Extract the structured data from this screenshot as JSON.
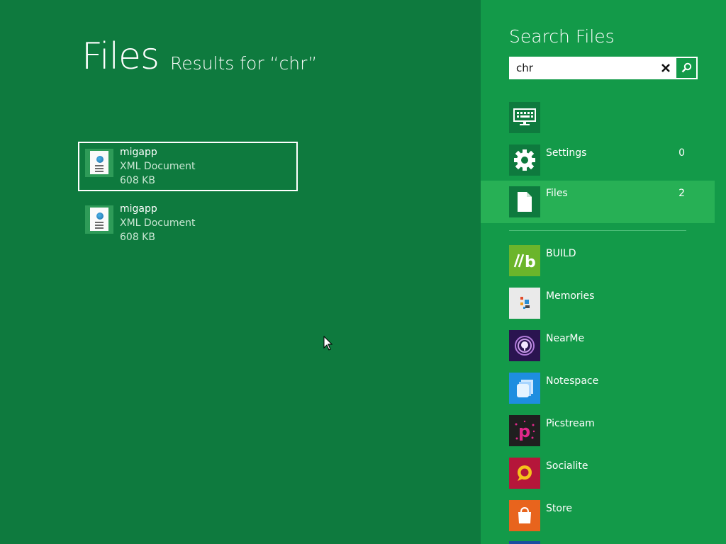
{
  "page": {
    "title": "Files",
    "subtitle": "Results for “chr”"
  },
  "results": [
    {
      "name": "migapp",
      "type": "XML Document",
      "size": "608 KB"
    },
    {
      "name": "migapp",
      "type": "XML Document",
      "size": "608 KB"
    }
  ],
  "search": {
    "title": "Search Files",
    "query": "chr"
  },
  "scopes": [
    {
      "label": "",
      "count": "",
      "icon": "keyboard-icon"
    },
    {
      "label": "Settings",
      "count": "0",
      "icon": "gear-icon"
    },
    {
      "label": "Files",
      "count": "2",
      "icon": "file-icon"
    }
  ],
  "apps": [
    {
      "label": "BUILD",
      "icon": "build-app-icon",
      "color": "#6bb52b"
    },
    {
      "label": "Memories",
      "icon": "memories-app-icon",
      "color": "#eaeaea"
    },
    {
      "label": "NearMe",
      "icon": "nearme-app-icon",
      "color": "#2a1450"
    },
    {
      "label": "Notespace",
      "icon": "notespace-app-icon",
      "color": "#1e8ee0"
    },
    {
      "label": "Picstream",
      "icon": "picstream-app-icon",
      "color": "#1f1f1f"
    },
    {
      "label": "Socialite",
      "icon": "socialite-app-icon",
      "color": "#b5163a"
    },
    {
      "label": "Store",
      "icon": "store-app-icon",
      "color": "#e8641d"
    }
  ],
  "colors": {
    "background": "#0e7a3e",
    "panel": "#139a49",
    "active_scope": "#27b055"
  }
}
